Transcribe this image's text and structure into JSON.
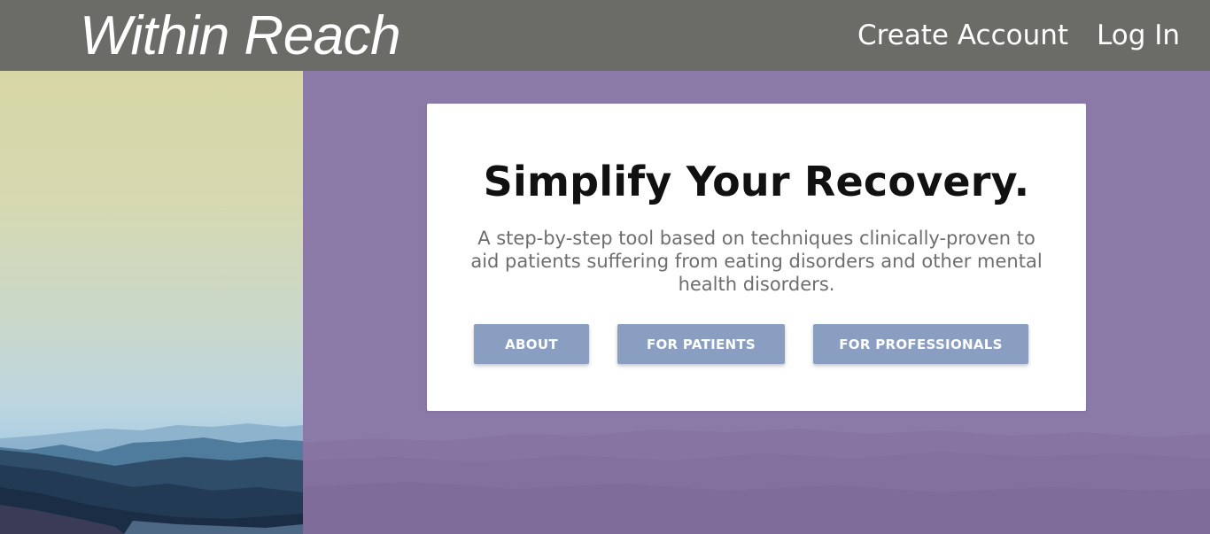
{
  "header": {
    "brand": "Within Reach",
    "nav": {
      "create_account": "Create Account",
      "log_in": "Log In"
    }
  },
  "hero": {
    "headline": "Simplify Your Recovery.",
    "description": "A step-by-step tool based on techniques clinically-proven to aid patients suffering from eating disorders and other mental health disorders.",
    "buttons": {
      "about": "ABOUT",
      "patients": "FOR PATIENTS",
      "professionals": "FOR PROFESSIONALS"
    }
  },
  "colors": {
    "header_bg": "#6b6b67",
    "hero_bg": "#8b79a8",
    "button_bg": "#8a9ec1",
    "card_bg": "#ffffff"
  }
}
